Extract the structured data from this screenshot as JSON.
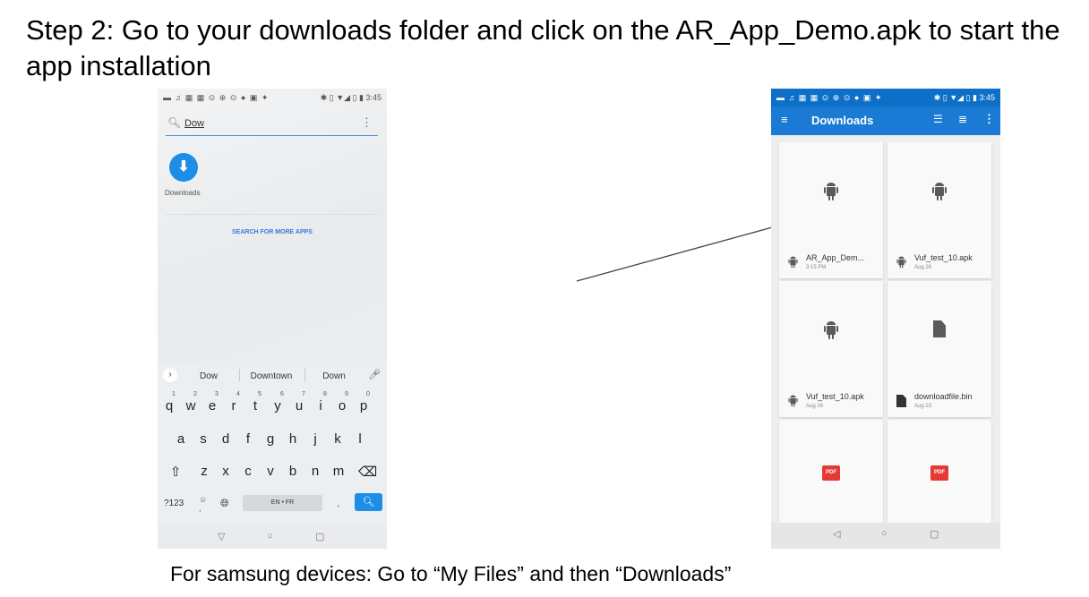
{
  "heading": "Step 2: Go to your downloads folder and click on the AR_App_Demo.apk to start the app installation",
  "footer_note": "For samsung devices: Go to “My Files” and then “Downloads”",
  "left_phone": {
    "status_time": "3:45",
    "status_icons": "▬ ♫ ▦ ▦ ⊙ ⊕ ⊙ ● ▣ ✦",
    "status_right": "✱ ▯ ▼◢ ▯ ▮",
    "search_query": "Dow",
    "app_result_label": "Downloads",
    "search_more_label": "SEARCH FOR MORE APPS",
    "suggestions": [
      "Dow",
      "Downtown",
      "Down"
    ],
    "keyboard_row1": [
      "q",
      "w",
      "e",
      "r",
      "t",
      "y",
      "u",
      "i",
      "o",
      "p"
    ],
    "keyboard_row1_digits": [
      "1",
      "2",
      "3",
      "4",
      "5",
      "6",
      "7",
      "8",
      "9",
      "0"
    ],
    "keyboard_row2": [
      "a",
      "s",
      "d",
      "f",
      "g",
      "h",
      "j",
      "k",
      "l"
    ],
    "keyboard_row3": [
      "z",
      "x",
      "c",
      "v",
      "b",
      "n",
      "m"
    ],
    "symbols_key": "?123",
    "comma_key": ",",
    "space_label": "EN • FR",
    "period_key": "."
  },
  "right_phone": {
    "status_time": "3:45",
    "status_icons": "▬ ♫ ▦ ▦ ⊙ ⊕ ⊙ ● ▣ ✦",
    "status_right": "✱ ▯ ▼◢ ▯ ▮",
    "title": "Downloads",
    "files": [
      {
        "name": "AR_App_Dem...",
        "date": "3:15 PM",
        "kind": "apk"
      },
      {
        "name": "Vuf_test_10.apk",
        "date": "Aug 26",
        "kind": "apk"
      },
      {
        "name": "Vuf_test_10.apk",
        "date": "Aug 26",
        "kind": "apk"
      },
      {
        "name": "downloadfile.bin",
        "date": "Aug 23",
        "kind": "file"
      },
      {
        "name": "",
        "date": "",
        "kind": "pdf"
      },
      {
        "name": "",
        "date": "",
        "kind": "pdf"
      }
    ],
    "pdf_badge": "PDF"
  },
  "icons": {
    "search": "search-icon",
    "overflow": "more-vert-icon",
    "download": "download-icon",
    "mic": "mic-icon",
    "shift": "shift-icon",
    "backspace": "backspace-icon",
    "globe": "globe-icon",
    "menu": "menu-icon",
    "grid": "list-view-icon",
    "sort": "sort-icon",
    "android": "android-icon",
    "back": "back-icon",
    "home": "home-icon",
    "recents": "recents-icon"
  },
  "colors": {
    "accent": "#1a7ad4",
    "statusbar_right": "#0d6fc8",
    "pdf_red": "#e53935",
    "app_icon_blue": "#1c8ee8"
  }
}
